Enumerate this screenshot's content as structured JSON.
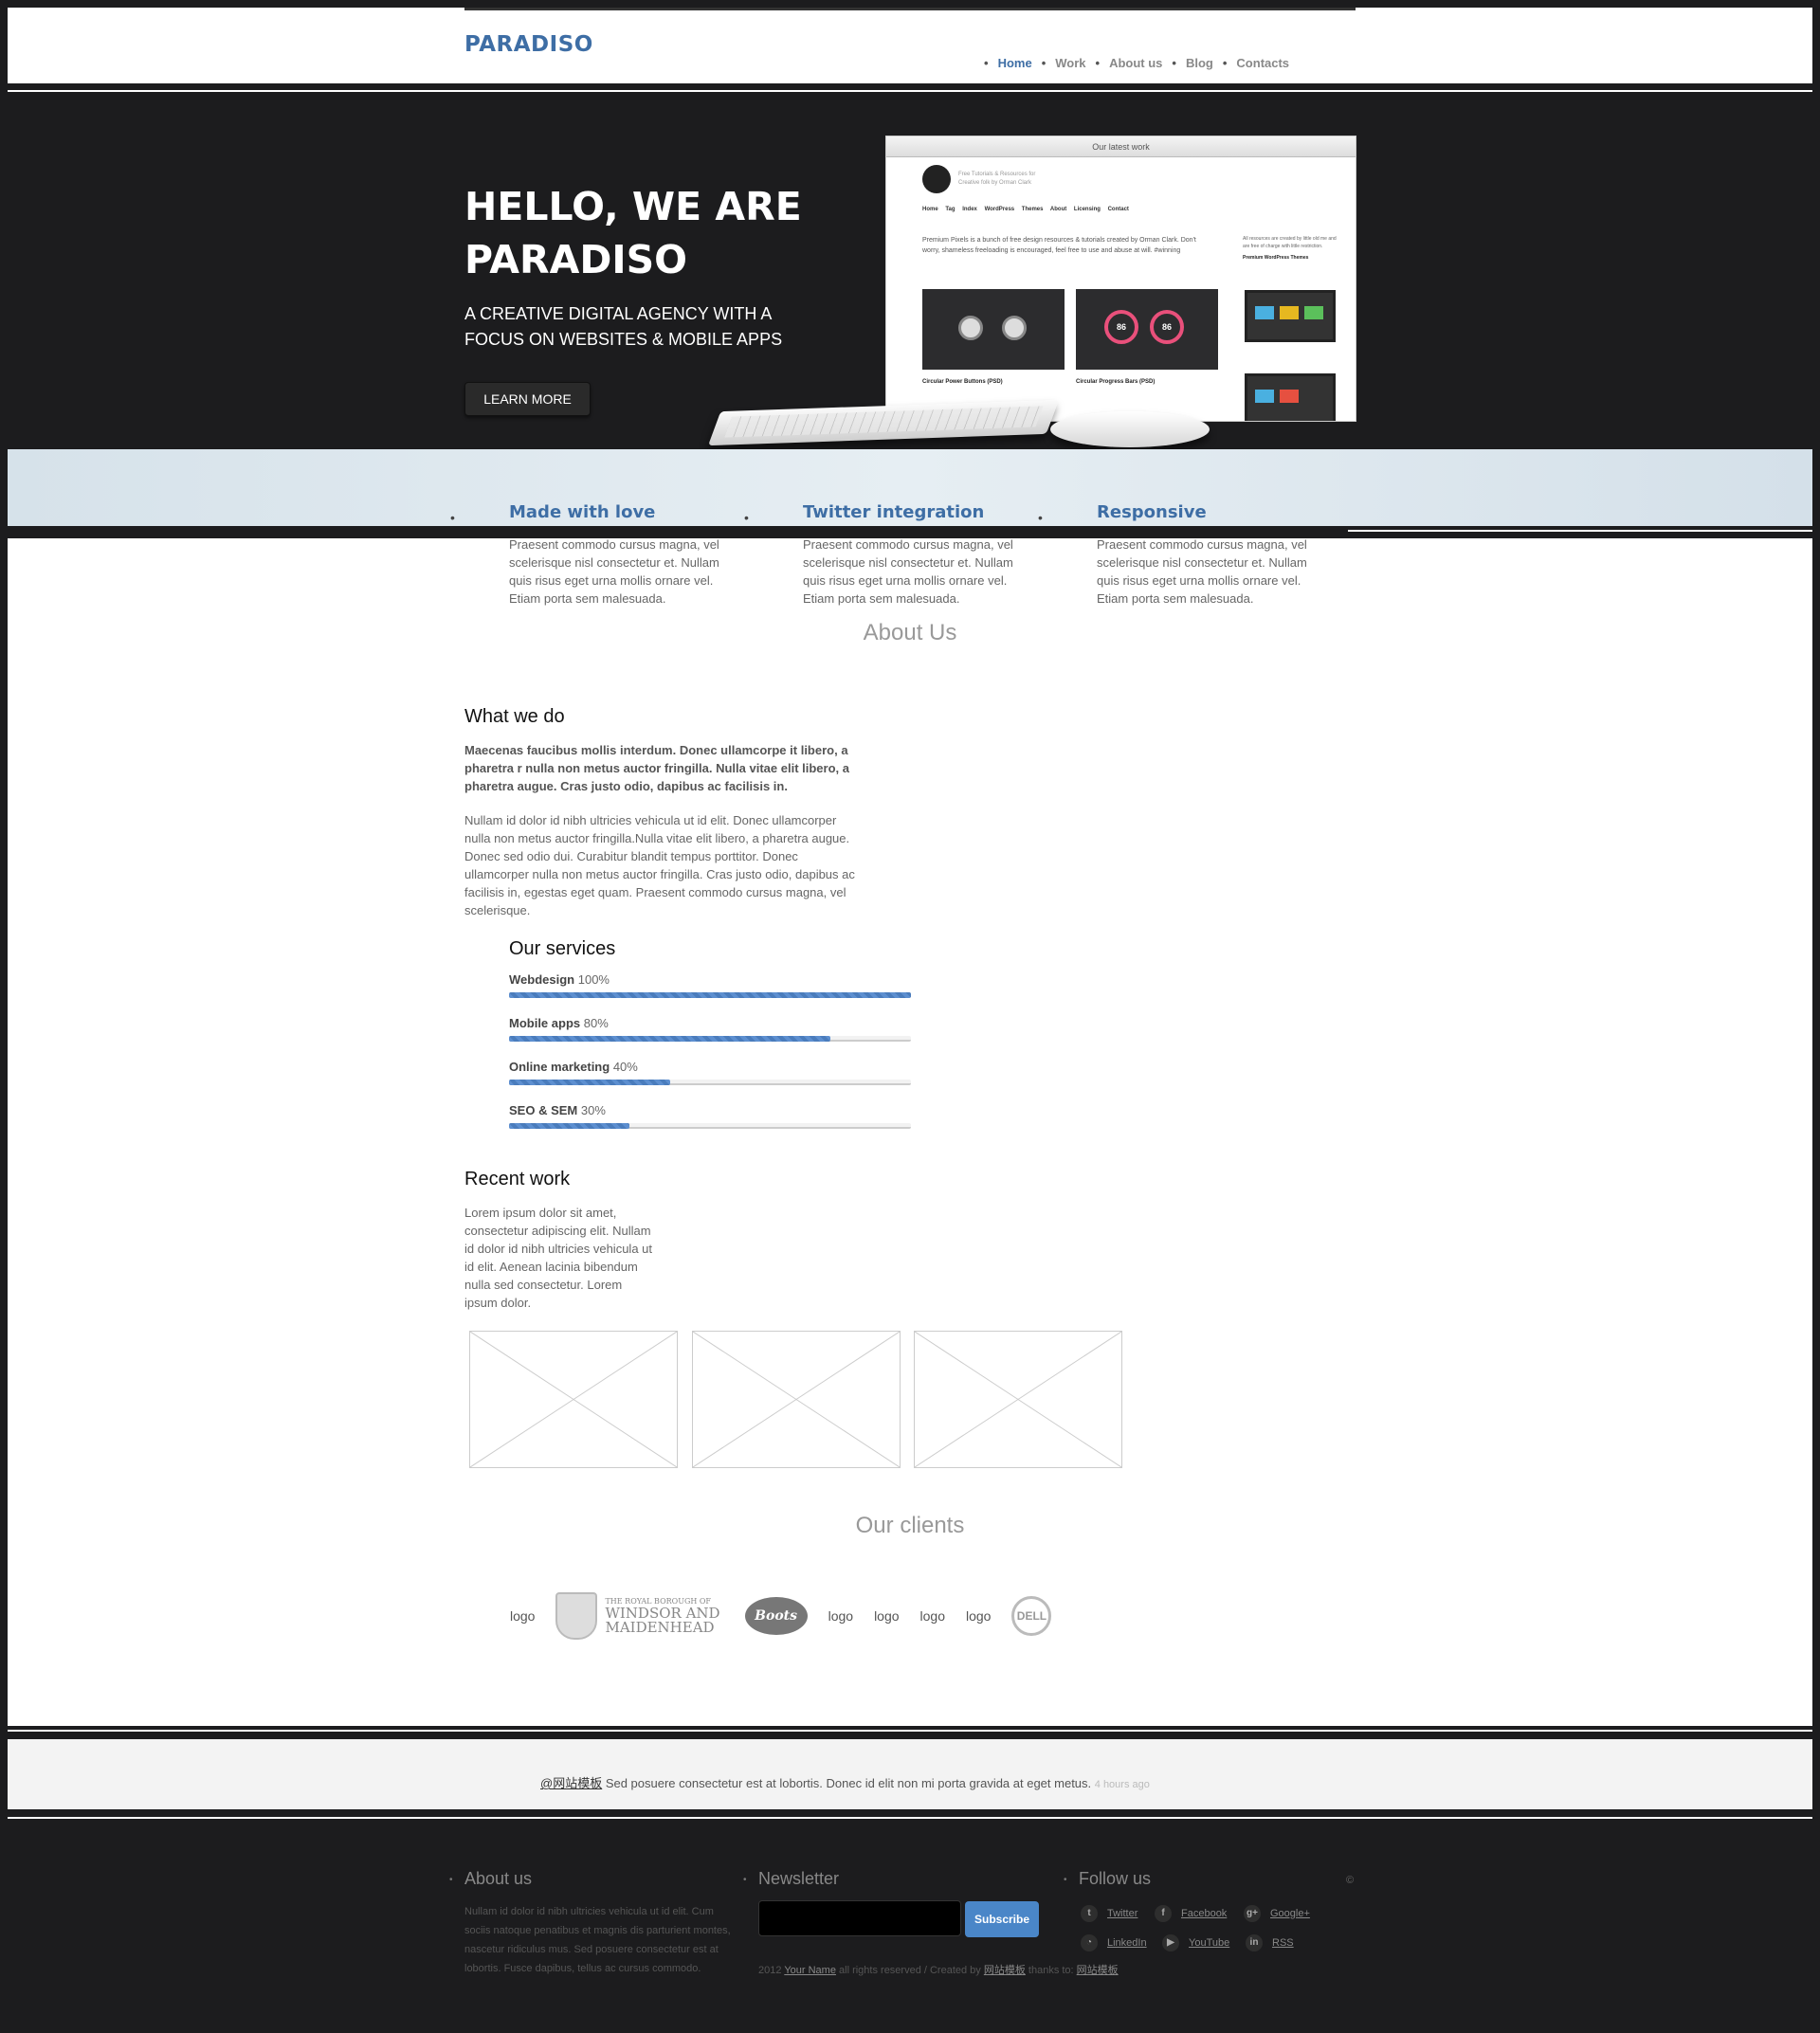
{
  "header": {
    "logo": "PARADISO",
    "nav": [
      {
        "label": "Home"
      },
      {
        "label": "Work"
      },
      {
        "label": "About us"
      },
      {
        "label": "Blog"
      },
      {
        "label": "Contacts"
      }
    ]
  },
  "hero": {
    "title_line1": "HELLO, WE ARE",
    "title_line2": "PARADISO",
    "subtitle_line1": "A CREATIVE DIGITAL AGENCY WITH A",
    "subtitle_line2": "FOCUS ON WEBSITES & MOBILE APPS",
    "button": "LEARN MORE",
    "showcase": {
      "bar_title": "Our latest work",
      "tagline": "Free Tutorials & Resources for Creative folk by Orman Clark",
      "menu": "Home Tag Index WordPress Themes About Licensing Contact",
      "intro": "Premium Pixels is a bunch of free design resources & tutorials created by Orman Clark. Don't worry, shameless freeloading is encouraged, feel free to use and abuse at will. #winning",
      "thumb1_caption": "Circular Power Buttons (PSD)",
      "thumb2_caption": "Circular Progress Bars (PSD)",
      "ring_value": "86",
      "side_text": "All resources are created by little old me and are free of charge with little restriction.",
      "side_heading": "Premium WordPress Themes"
    }
  },
  "features": [
    {
      "title": "Made with love",
      "text": "Praesent commodo cursus magna, vel scelerisque nisl consectetur et. Nullam quis risus eget urna mollis ornare vel. Etiam porta sem malesuada."
    },
    {
      "title": "Twitter integration",
      "text": "Praesent commodo cursus magna, vel scelerisque nisl consectetur et. Nullam quis risus eget urna mollis ornare vel. Etiam porta sem malesuada."
    },
    {
      "title": "Responsive",
      "text": "Praesent commodo cursus magna, vel scelerisque nisl consectetur et. Nullam quis risus eget urna mollis ornare vel. Etiam porta sem malesuada."
    }
  ],
  "about": {
    "section_title": "About Us",
    "what_we_do": "What we do",
    "lead": "Maecenas faucibus mollis interdum. Donec ullamcorpe it libero, a pharetra r nulla non metus auctor fringilla. Nulla vitae elit libero, a pharetra augue. Cras justo odio, dapibus ac facilisis in.",
    "paragraph": "Nullam id dolor id nibh ultricies vehicula ut id elit. Donec ullamcorper nulla non metus auctor fringilla.Nulla vitae elit libero, a pharetra augue. Donec sed odio dui. Curabitur blandit tempus porttitor. Donec ullamcorper nulla non metus auctor fringilla. Cras justo odio, dapibus ac facilisis in, egestas eget quam. Praesent commodo cursus magna, vel scelerisque."
  },
  "services": {
    "title": "Our services",
    "items": [
      {
        "name": "Webdesign",
        "percent_label": "100%",
        "percent": 100
      },
      {
        "name": "Mobile apps",
        "percent_label": "80%",
        "percent": 80
      },
      {
        "name": "Online marketing",
        "percent_label": "40%",
        "percent": 40
      },
      {
        "name": "SEO & SEM",
        "percent_label": "30%",
        "percent": 30
      }
    ]
  },
  "recent_work": {
    "title": "Recent work",
    "text": "Lorem ipsum dolor sit amet, consectetur adipiscing elit. Nullam id dolor id nibh ultricies vehicula ut id elit. Aenean lacinia bibendum nulla sed consectetur. Lorem ipsum dolor."
  },
  "clients": {
    "title": "Our clients",
    "logo_alt": "logo",
    "windsor_small": "THE ROYAL BOROUGH OF",
    "windsor_line1": "WINDSOR AND",
    "windsor_line2": "MAIDENHEAD",
    "boots": "Boots",
    "dell": "DELL"
  },
  "tweet": {
    "handle": "@网站模板",
    "text": " Sed posuere consectetur est at lobortis. Donec id elit non mi porta gravida at eget metus. ",
    "time": "4 hours ago"
  },
  "footer": {
    "about_title": "About us",
    "about_text": "Nullam id dolor id nibh ultricies vehicula ut id elit. Cum sociis natoque penatibus et magnis dis parturient montes, nascetur ridiculus mus. Sed posuere consectetur est at lobortis. Fusce dapibus, tellus ac cursus commodo.",
    "newsletter_title": "Newsletter",
    "subscribe": "Subscribe",
    "copyright_prefix": "2012 ",
    "copyright_name": "Your Name",
    "copyright_mid": " all rights reserved / Created by ",
    "copyright_creator": "网站模板",
    "copyright_thanks": " thanks to: ",
    "copyright_thanks_link": "网站模板",
    "follow_title": "Follow us",
    "copy_symbol": "©",
    "social": [
      {
        "label": "Twitter",
        "icon": "twitter-icon",
        "glyph": "t"
      },
      {
        "label": "Facebook",
        "icon": "facebook-icon",
        "glyph": "f"
      },
      {
        "label": "Google+",
        "icon": "google-plus-icon",
        "glyph": "g+"
      },
      {
        "label": "LinkedIn",
        "icon": "rss-feed-icon",
        "glyph": "◔"
      },
      {
        "label": "YouTube",
        "icon": "youtube-icon",
        "glyph": "▶"
      },
      {
        "label": "RSS",
        "icon": "linkedin-icon",
        "glyph": "in"
      }
    ]
  }
}
